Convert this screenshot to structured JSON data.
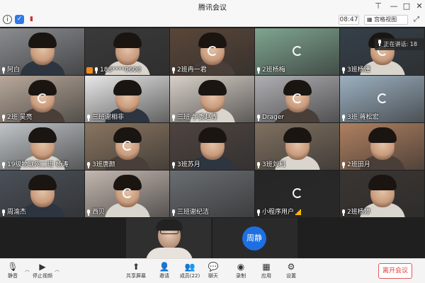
{
  "window": {
    "title": "腾讯会议"
  },
  "infobar": {
    "time": "08:47",
    "view_label": "宫格视图"
  },
  "participants": [
    {
      "name": "阿白",
      "bg": "#8a8c90",
      "skin": true,
      "spinner": false
    },
    {
      "name": "188****0608",
      "bg": "#3a3a3a",
      "skin": true,
      "spinner": false,
      "owner": true
    },
    {
      "name": "2班冉一君",
      "bg": "#5a4638",
      "skin": true,
      "spinner": true
    },
    {
      "name": "2班杨梅",
      "bg": "#7fa590",
      "skin": false,
      "spinner": true
    },
    {
      "name": "3班杨谨",
      "bg": "#35404a",
      "skin": true,
      "spinner": true
    },
    {
      "name": "2班 吴亮",
      "bg": "#b8a89a",
      "skin": true,
      "spinner": true
    },
    {
      "name": "三班谢相非",
      "bg": "#e8e8e8",
      "skin": true,
      "spinner": false
    },
    {
      "name": "三班 学委赵青",
      "bg": "#d8d0c8",
      "skin": true,
      "spinner": false
    },
    {
      "name": "Drager",
      "bg": "#b0b0b4",
      "skin": true,
      "spinner": true
    },
    {
      "name": "3班 蒋松宏",
      "bg": "#9cb0c0",
      "skin": false,
      "spinner": true
    },
    {
      "name": "19级物联网二班 杨涛",
      "bg": "#c0c4c8",
      "skin": true,
      "spinner": false
    },
    {
      "name": "3班唐颜",
      "bg": "#8a7560",
      "skin": true,
      "spinner": true
    },
    {
      "name": "3班苏月",
      "bg": "#4e4440",
      "skin": true,
      "spinner": false
    },
    {
      "name": "3班刘利",
      "bg": "#807060",
      "skin": true,
      "spinner": false
    },
    {
      "name": "2班田月",
      "bg": "#b08060",
      "skin": true,
      "spinner": false
    },
    {
      "name": "周渝杰",
      "bg": "#4a5058",
      "skin": true,
      "spinner": false
    },
    {
      "name": "西贝",
      "bg": "#c4b8b0",
      "skin": true,
      "spinner": true
    },
    {
      "name": "三班谢纪洁",
      "bg": "#6a6e72",
      "skin": false,
      "spinner": false
    },
    {
      "name": "小程序用户",
      "bg": "#262626",
      "skin": false,
      "spinner": true,
      "signal": true
    },
    {
      "name": "2班杨婷",
      "bg": "#3a3532",
      "skin": true,
      "spinner": false
    }
  ],
  "speaking": {
    "label": "正在讲话: 18"
  },
  "host": {
    "initials": "周静"
  },
  "toolbar": {
    "mute": "静音",
    "video": "停止视频",
    "share": "共享屏幕",
    "invite": "邀请",
    "members": "成员(22)",
    "chat": "聊天",
    "record": "录制",
    "apps": "应用",
    "settings": "设置",
    "leave": "离开会议"
  },
  "colors": {
    "host_avatar": "#1e6fe0",
    "leave_red": "#e04040",
    "owner_orange": "#f08b1f"
  }
}
